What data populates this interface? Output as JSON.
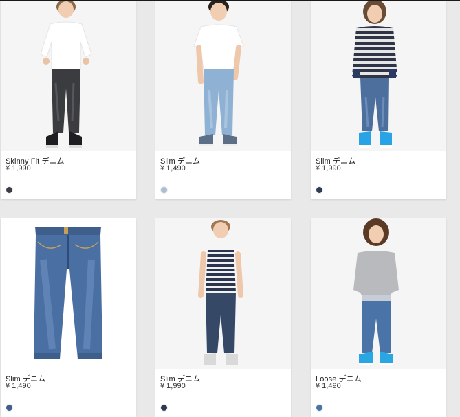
{
  "products": [
    {
      "name": "Skinny Fit デニム",
      "price": "¥ 1,990",
      "swatch_color": "#3a3d43",
      "image": "boy-white-henley-black-jeans"
    },
    {
      "name": "Slim デニム",
      "price": "¥ 1,490",
      "swatch_color": "#aabfd3",
      "image": "boy-white-tee-light-jeans"
    },
    {
      "name": "Slim デニム",
      "price": "¥ 1,990",
      "swatch_color": "#2f3b52",
      "image": "boy-striped-sweater-jeans"
    },
    {
      "name": "Slim デニム",
      "price": "¥ 1,490",
      "swatch_color": "#3f5f8c",
      "image": "folded-blue-jeans"
    },
    {
      "name": "Slim デニム",
      "price": "¥ 1,990",
      "swatch_color": "#2f3b52",
      "image": "boy-striped-tank-jeans"
    },
    {
      "name": "Loose デニム",
      "price": "¥ 1,490",
      "swatch_color": "#4a74a8",
      "image": "boy-grey-tee-jogger-jeans"
    }
  ]
}
